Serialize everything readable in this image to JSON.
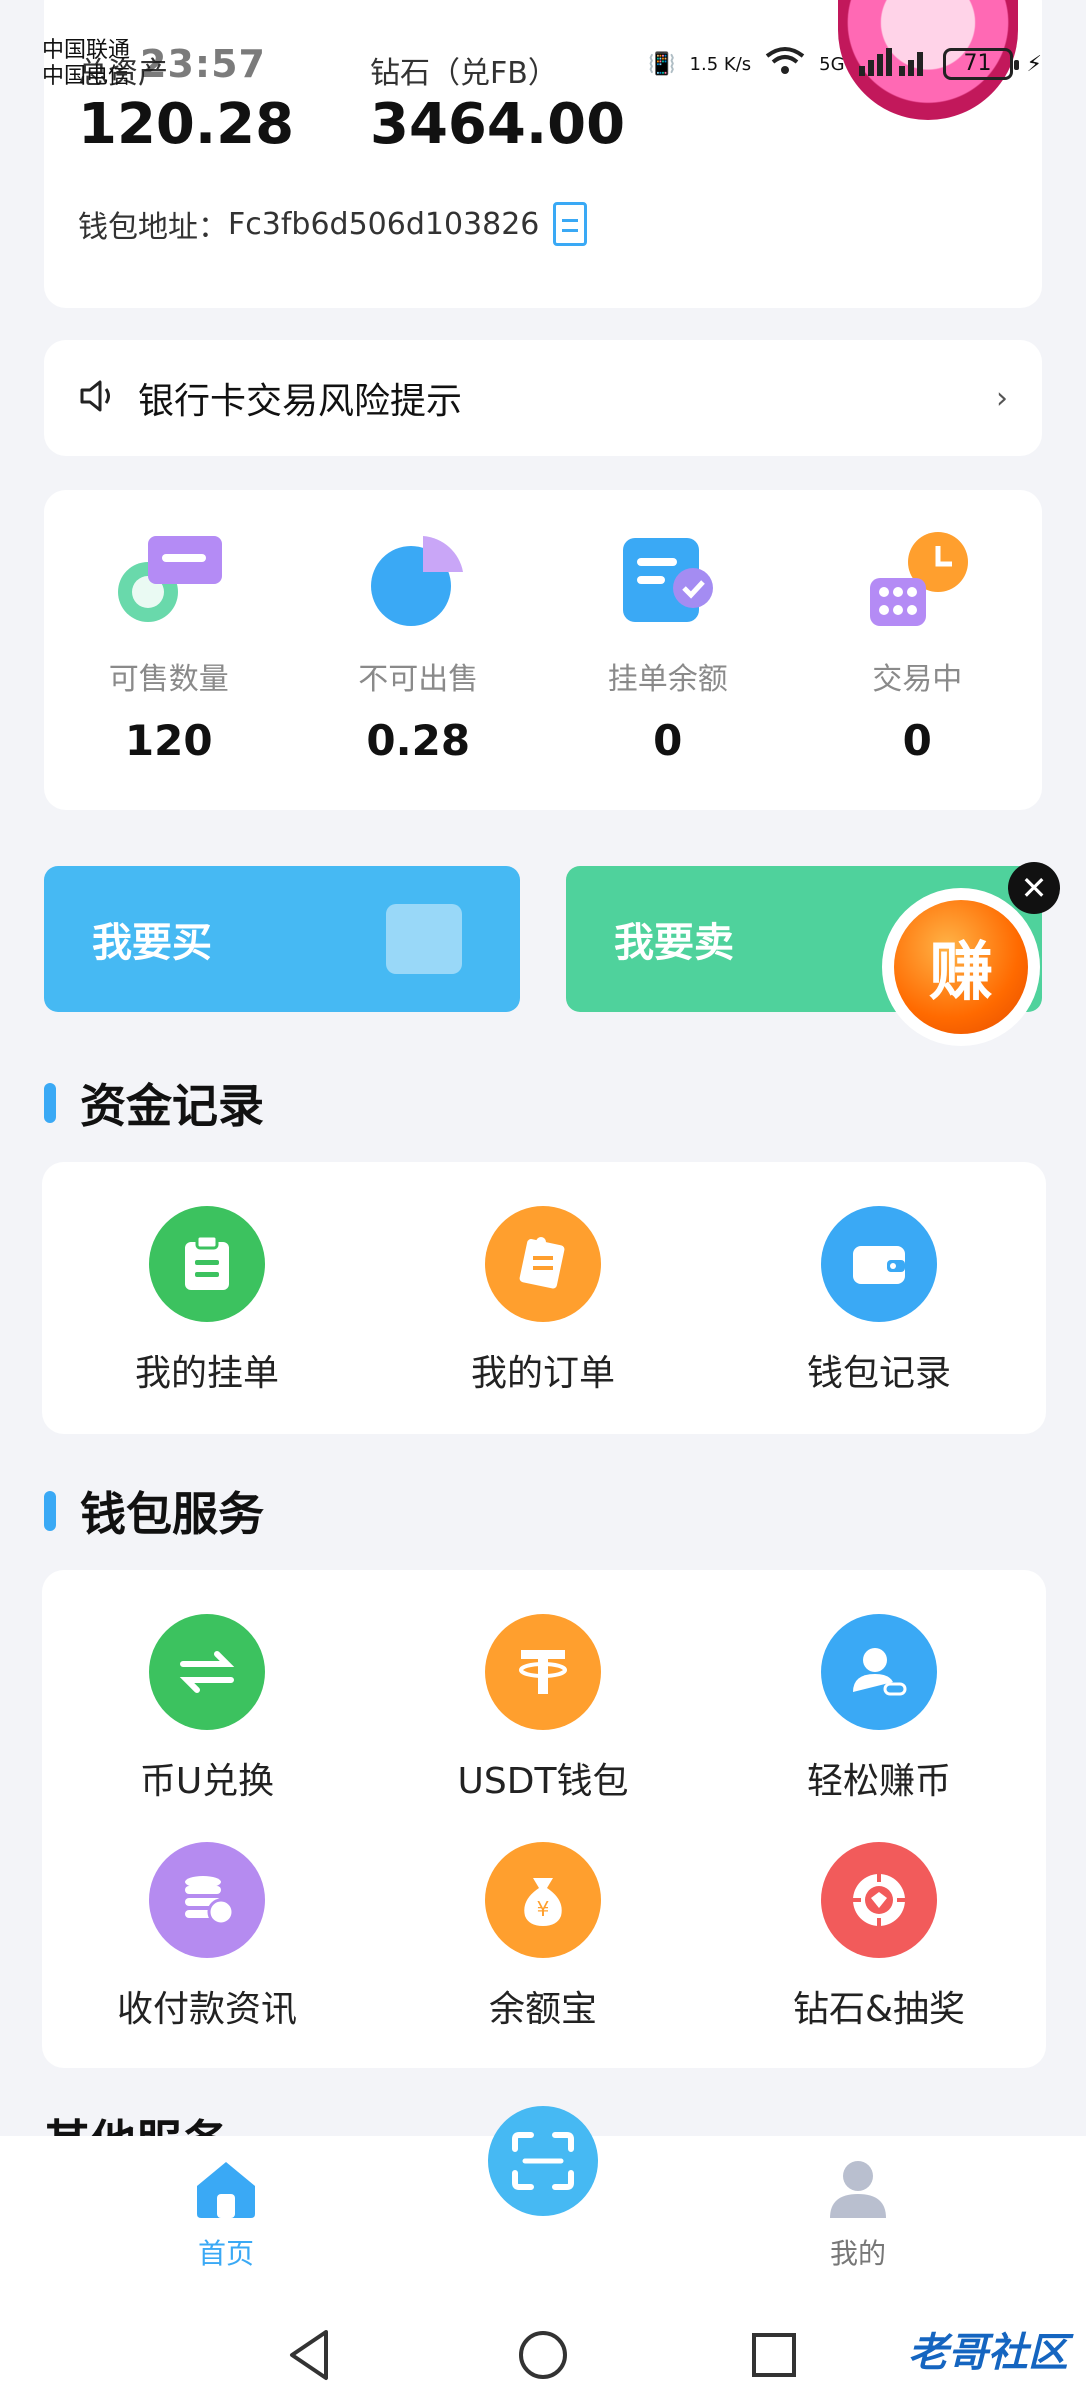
{
  "status_bar": {
    "carrier_1": "中国联通",
    "carrier_2": "中国电信",
    "time": "23:57",
    "net_speed": "1.5 K/s",
    "net_type": "5G",
    "battery": "71"
  },
  "balance": {
    "left_label": "总资产",
    "left_value": "120.28",
    "right_label": "钻石（兑FB）",
    "right_value": "3464.00",
    "wallet_label": "钱包地址：",
    "wallet_address": "Fc3fb6d506d103826"
  },
  "notice": {
    "text": "银行卡交易风险提示"
  },
  "stats": [
    {
      "label": "可售数量",
      "value": "120"
    },
    {
      "label": "不可出售",
      "value": "0.28"
    },
    {
      "label": "挂单余额",
      "value": "0"
    },
    {
      "label": "交易中",
      "value": "0"
    }
  ],
  "actions": {
    "buy": "我要买",
    "sell": "我要卖",
    "earn_badge": "赚",
    "close": "✕"
  },
  "fund_records": {
    "title": "资金记录",
    "items": [
      {
        "label": "我的挂单",
        "color": "#3cc25f"
      },
      {
        "label": "我的订单",
        "color": "#ff9f2e"
      },
      {
        "label": "钱包记录",
        "color": "#3aa9f5"
      }
    ]
  },
  "wallet_services": {
    "title": "钱包服务",
    "items": [
      {
        "label": "币U兑换",
        "color": "#3cc25f"
      },
      {
        "label": "USDT钱包",
        "color": "#ff9f2e"
      },
      {
        "label": "轻松赚币",
        "color": "#3aa9f5"
      },
      {
        "label": "收付款资讯",
        "color": "#b58bf0"
      },
      {
        "label": "余额宝",
        "color": "#ff9f2e"
      },
      {
        "label": "钻石&抽奖",
        "color": "#f25b5b"
      }
    ]
  },
  "other_services": {
    "title": "其他服务"
  },
  "bottom_nav": {
    "home": "首页",
    "mine": "我的"
  },
  "watermark": "老哥社区",
  "colors": {
    "accent": "#3aa9f5",
    "buy": "#46b9f3",
    "sell": "#4fd29c"
  }
}
